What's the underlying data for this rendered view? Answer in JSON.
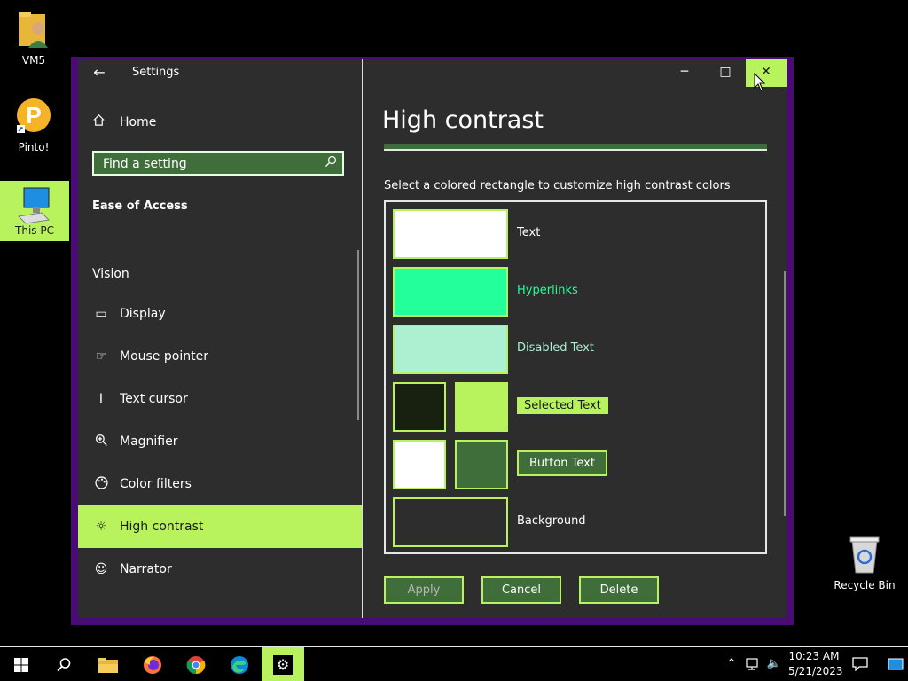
{
  "desktop": {
    "icons": [
      {
        "label": "VM5",
        "icon": "user-folder-icon"
      },
      {
        "label": "Pinto!",
        "icon": "pinto-shortcut-icon"
      },
      {
        "label": "This PC",
        "icon": "computer-icon"
      },
      {
        "label": "Recycle Bin",
        "icon": "recycle-bin-icon"
      }
    ]
  },
  "settings": {
    "app_title": "Settings",
    "back_icon": "back-arrow-icon",
    "controls": {
      "minimize": "minimize-icon",
      "maximize": "maximize-icon",
      "close": "close-icon"
    },
    "sidebar": {
      "home_label": "Home",
      "search_placeholder": "Find a setting",
      "section_title": "Ease of Access",
      "group_label": "Vision",
      "items": [
        {
          "label": "Display",
          "icon": "display-icon"
        },
        {
          "label": "Mouse pointer",
          "icon": "mouse-pointer-icon"
        },
        {
          "label": "Text cursor",
          "icon": "text-cursor-icon"
        },
        {
          "label": "Magnifier",
          "icon": "magnifier-icon"
        },
        {
          "label": "Color filters",
          "icon": "color-filters-icon"
        },
        {
          "label": "High contrast",
          "icon": "high-contrast-icon",
          "selected": true
        },
        {
          "label": "Narrator",
          "icon": "narrator-icon"
        }
      ]
    },
    "main": {
      "page_title": "High contrast",
      "instruction": "Select a colored rectangle to customize high contrast colors",
      "colors": {
        "text_swatch": "#ffffff",
        "hyperlink_swatch": "#23ff99",
        "disabled_swatch": "#aaf0d1",
        "selected_bg": "#18200f",
        "selected_fg": "#b8f35e",
        "button_bg": "#ffffff",
        "button_fg": "#3f6e3a",
        "background": "#2d2d2d",
        "accent": "#b8f35e"
      },
      "rows": {
        "text": "Text",
        "hyperlinks": "Hyperlinks",
        "disabled_text": "Disabled Text",
        "selected_text": "Selected Text",
        "button_text": "Button Text",
        "background": "Background"
      },
      "buttons": {
        "apply": "Apply",
        "cancel": "Cancel",
        "delete": "Delete"
      }
    }
  },
  "taskbar": {
    "apps": [
      "start-icon",
      "search-icon",
      "file-explorer-icon",
      "firefox-icon",
      "chrome-icon",
      "edge-icon",
      "settings-gear-icon"
    ],
    "active_app": "settings-gear-icon",
    "time": "10:23 AM",
    "date": "5/21/2023"
  }
}
